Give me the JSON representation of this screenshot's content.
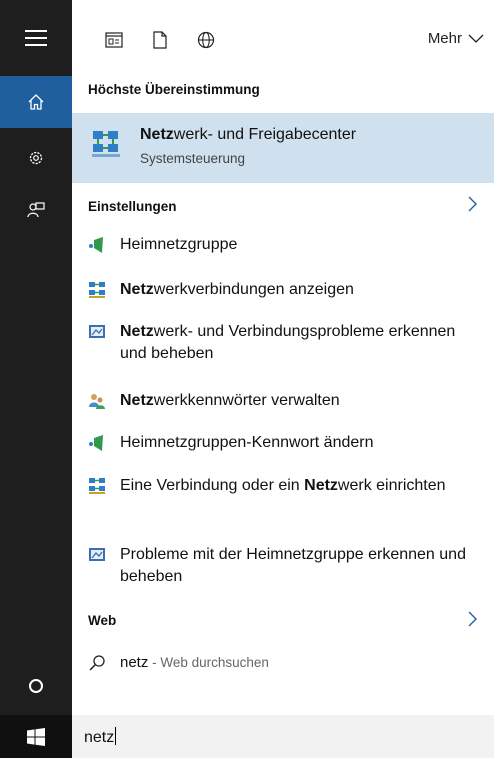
{
  "toolbar": {
    "more_label": "Mehr"
  },
  "best_match": {
    "header": "Höchste Übereinstimmung",
    "title_bold": "Netz",
    "title_rest": "werk- und Freigabecenter",
    "subtitle": "Systemsteuerung"
  },
  "settings": {
    "header": "Einstellungen",
    "items": [
      {
        "pre": "",
        "bold": "",
        "post": "Heimnetzgruppe",
        "icon": "homegroup-icon"
      },
      {
        "pre": "",
        "bold": "Netz",
        "post": "werkverbindungen anzeigen",
        "icon": "network-icon"
      },
      {
        "pre": "",
        "bold": "Netz",
        "post": "werk- und Verbindungsprobleme erkennen und beheben",
        "icon": "troubleshoot-icon"
      },
      {
        "pre": "",
        "bold": "Netz",
        "post": "werkkennwörter verwalten",
        "icon": "users-icon"
      },
      {
        "pre": "",
        "bold": "",
        "post": "Heimnetzgruppen-Kennwort ändern",
        "icon": "homegroup-icon"
      },
      {
        "pre": "Eine Verbindung oder ein ",
        "bold": "Netz",
        "post": "werk einrichten",
        "icon": "network-icon"
      },
      {
        "pre": "",
        "bold": "",
        "post": "Probleme mit der Heimnetzgruppe erkennen und beheben",
        "icon": "troubleshoot-icon"
      }
    ]
  },
  "web": {
    "header": "Web",
    "query": "netz",
    "suffix": " - Web durchsuchen"
  },
  "search": {
    "value": "netz"
  },
  "colors": {
    "rail": "#1e1e1e",
    "accent": "#1f5f9e",
    "highlight": "#cfe1ef"
  }
}
